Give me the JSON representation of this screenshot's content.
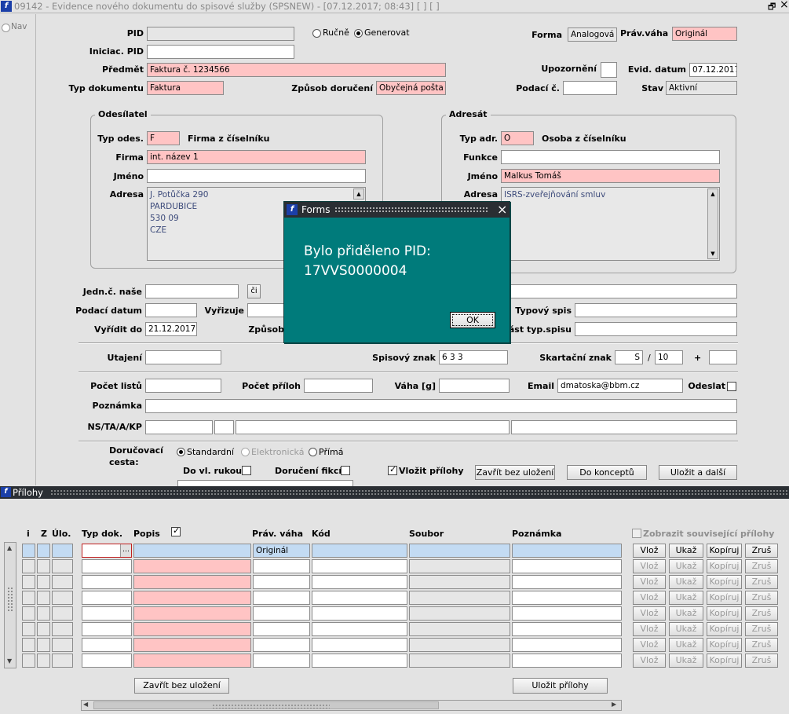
{
  "window": {
    "title": "09142 - Evidence nového dokumentu do spisové služby (SPSNEW) - [07.12.2017; 08:43]  [ ]  [ ]",
    "restore_glyph": "🗗",
    "close_glyph": "×"
  },
  "side": {
    "nav": "Nav"
  },
  "header": {
    "pid_label": "PID",
    "pid_value": "",
    "rucne_label": "Ručně",
    "generovat_label": "Generovat",
    "forma_label": "Forma",
    "forma_value": "Analogová",
    "prav_vaha_label": "Práv.váha",
    "prav_vaha_value": "Originál",
    "iniciac_pid_label": "Iniciac. PID",
    "iniciac_pid_value": "",
    "predmet_label": "Předmět",
    "predmet_value": "Faktura č. 1234566",
    "upozorneni_label": "Upozornění",
    "evid_datum_label": "Evid. datum",
    "evid_datum_value": "07.12.2017",
    "typ_dokumentu_label": "Typ dokumentu",
    "typ_dokumentu_value": "Faktura",
    "zpusob_doruceni_label": "Způsob doručení",
    "zpusob_doruceni_value": "Obyčejná pošta",
    "podaci_c_label": "Podací č.",
    "podaci_c_value": "",
    "stav_label": "Stav",
    "stav_value": "Aktivní"
  },
  "odesilatel": {
    "title": "Odesílatel",
    "typ_label": "Typ odes.",
    "typ_value": "F",
    "typ_desc": "Firma z číselníku",
    "firma_label": "Firma",
    "firma_value": "int. název 1",
    "jmeno_label": "Jméno",
    "jmeno_value": "",
    "adresa_label": "Adresa",
    "adresa_lines": [
      "J. Potůčka 290",
      "PARDUBICE",
      "530 09",
      "CZE"
    ]
  },
  "adresat": {
    "title": "Adresát",
    "typ_label": "Typ adr.",
    "typ_value": "O",
    "typ_desc": "Osoba z číselníku",
    "funkce_label": "Funkce",
    "funkce_value": "",
    "jmeno_label": "Jméno",
    "jmeno_value": "Malkus Tomáš",
    "adresa_label": "Adresa",
    "adresa_value": "ISRS-zveřejňování smluv"
  },
  "mid": {
    "jedn_label": "Jedn.č. naše",
    "ci_button": "či",
    "podaci_datum_label": "Podací datum",
    "vyrizuje_label": "Vyřizuje",
    "vyridit_do_label": "Vyřídit do",
    "vyridit_do_value": "21.12.2017",
    "zpusob_label": "Způsob",
    "typovy_spis_label": "Typový spis",
    "cast_typ_spisu_label": "část typ.spisu",
    "utajeni_label": "Utajení",
    "spisovy_znak_label": "Spisový znak",
    "spisovy_znak_value": "6 3 3",
    "skartacni_znak_label": "Skartační znak",
    "skartacni_s": "S",
    "slash": "/",
    "skartacni_num": "10",
    "plus": "+",
    "pocet_listu_label": "Počet listů",
    "pocet_priloh_label": "Počet příloh",
    "vaha_label": "Váha [g]",
    "email_label": "Email",
    "email_value": "dmatoska@bbm.cz",
    "odeslat_label": "Odeslat",
    "poznamka_label": "Poznámka",
    "ns_label": "NS/TA/A/KP",
    "dorucovaci_label_1": "Doručovací",
    "dorucovaci_label_2": "cesta:",
    "standardni": "Standardní",
    "elektronicka": "Elektronická",
    "prima": "Přímá",
    "do_vl_rukou": "Do vl. rukou",
    "doruceni_fikci": "Doručení fikcí",
    "vlozit_prilohy": "Vložit přílohy",
    "zavrit_bez_ulozeni": "Zavřít bez uložení",
    "do_konceptu": "Do konceptů",
    "ulozit_a_dalsi": "Uložit a další"
  },
  "prilohy": {
    "title": "Přílohy",
    "zobrazit": "Zobrazit související přílohy",
    "col_i": "i",
    "col_z": "Z",
    "col_ulo": "Úlo.",
    "col_typ": "Typ dok.",
    "col_popis": "Popis",
    "col_prav": "Práv. váha",
    "col_kod": "Kód",
    "col_soubor": "Soubor",
    "col_poznamka": "Poznámka",
    "first_prav": "Originál",
    "btn_vloz": "Vlož",
    "btn_ukaz": "Ukaž",
    "btn_kopiruj": "Kopíruj",
    "btn_zrus": "Zruš",
    "zavrit": "Zavřít bez uložení",
    "ulozit": "Uložit přílohy",
    "scroll_up": "▲",
    "scroll_down": "▼",
    "scroll_left": "◀",
    "scroll_right": "▶"
  },
  "dialog": {
    "title": "Forms",
    "line1": "Bylo přiděleno PID:",
    "line2": "17VVS0000004",
    "ok": "OK",
    "close": "×"
  },
  "colors": {
    "titlebar": "#1b4ea3",
    "dialog_bg": "#007b7b",
    "pink": "#ffc4c4",
    "blue": "#c3dbf3"
  }
}
